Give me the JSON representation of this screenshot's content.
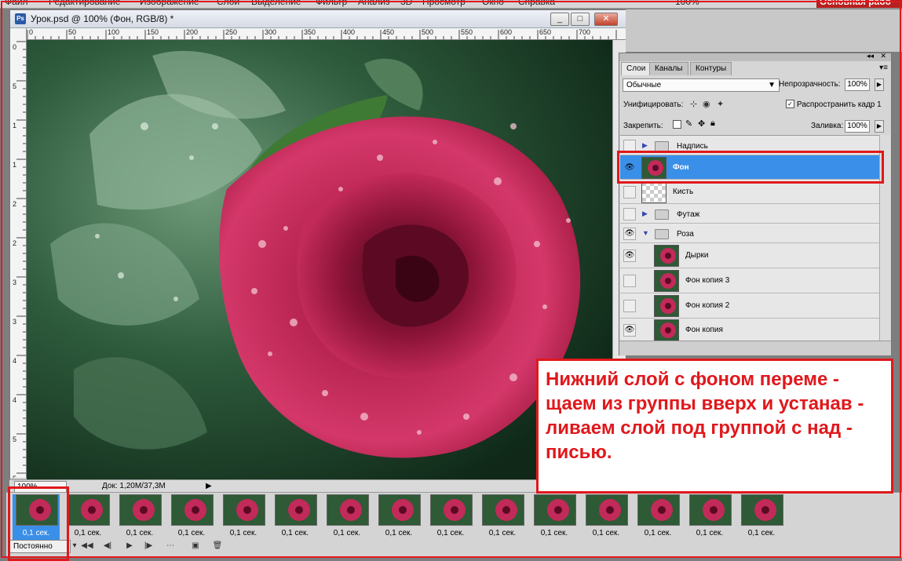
{
  "menubar": {
    "items": [
      "Файл",
      "Редактирование",
      "Изображение",
      "Слой",
      "Выделение",
      "Фильтр",
      "Анализ",
      "3D",
      "Просмотр",
      "Окно",
      "Справка"
    ],
    "zoom": "100%",
    "workspace": "Основная рабо та"
  },
  "document": {
    "title": "Урок.psd @ 100% (Фон, RGB/8) *",
    "logo": "Ps",
    "ruler_top": [
      "0",
      "50",
      "100",
      "150",
      "200",
      "250",
      "300",
      "350",
      "400",
      "450",
      "500",
      "550",
      "600",
      "650",
      "700"
    ],
    "ruler_left": [
      "0",
      "5",
      "1",
      "1",
      "2",
      "2",
      "3",
      "3",
      "4",
      "4",
      "5",
      "5"
    ]
  },
  "window_buttons": {
    "minimize": "_",
    "restore": "□",
    "close": "✕"
  },
  "statusbar": {
    "zoom": "100%",
    "doc": "Док: 1,20M/37,3M"
  },
  "animation": {
    "frames": [
      "0,1 сек.",
      "0,1 сек.",
      "0,1 сек.",
      "0,1 сек.",
      "0,1 сек.",
      "0,1 сек.",
      "0,1 сек.",
      "0,1 сек.",
      "0,1 сек.",
      "0,1 сек.",
      "0,1 сек.",
      "0,1 сек.",
      "0,1 сек.",
      "0,1 сек.",
      "0,1 сек."
    ],
    "loop": "Постоянно"
  },
  "layers_panel": {
    "tabs": [
      "Слои",
      "Каналы",
      "Контуры"
    ],
    "blend_mode": "Обычные",
    "opacity_label": "Непрозрачность:",
    "opacity": "100%",
    "unify_label": "Унифицировать:",
    "propagate_label": "Распространить кадр 1",
    "lock_label": "Закрепить:",
    "fill_label": "Заливка:",
    "fill": "100%",
    "layers": [
      {
        "name": "Надпись",
        "type": "group",
        "visible": false,
        "collapsed": true
      },
      {
        "name": "Фон",
        "type": "layer",
        "visible": true,
        "selected": true
      },
      {
        "name": "Кисть",
        "type": "layer",
        "visible": false
      },
      {
        "name": "Футаж",
        "type": "group",
        "visible": false,
        "collapsed": true
      },
      {
        "name": "Роза",
        "type": "group",
        "visible": true,
        "collapsed": false
      },
      {
        "name": "Дырки",
        "type": "layer",
        "visible": true
      },
      {
        "name": "Фон копия 3",
        "type": "layer",
        "visible": false
      },
      {
        "name": "Фон копия 2",
        "type": "layer",
        "visible": false
      },
      {
        "name": "Фон копия",
        "type": "layer",
        "visible": true
      }
    ]
  },
  "annotation": {
    "text": "Нижний слой с фоном переме - щаем из группы вверх и установ - ливаем слой под группой с над - писью.",
    "lines": [
      "Нижний слой с фоном переме -",
      "щаем из группы вверх и устанав -",
      "ливаем слой под группой с над -",
      "писью."
    ],
    "color": "#e0181c"
  }
}
